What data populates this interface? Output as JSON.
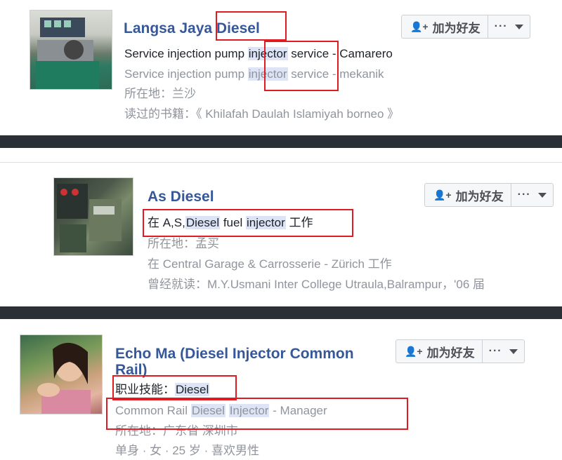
{
  "add_friend_label": "加为好友",
  "more_label": "···",
  "results": [
    {
      "name": "Langsa Jaya Diesel",
      "name_parts": [
        "Langsa Jaya ",
        "Diesel"
      ],
      "line1": [
        "Service injection pump ",
        "injector",
        " service - Camarero"
      ],
      "line2": [
        "Service injection pump ",
        "injector",
        " service - mekanik"
      ],
      "line3": "所在地：兰沙",
      "line4": "读过的书籍：《 Khilafah Daulah Islamiyah borneo 》"
    },
    {
      "name": "As Diesel",
      "line1": [
        "在 A,S,",
        "Diesel",
        " fuel ",
        "injector",
        " 工作"
      ],
      "line2": "所在地：孟买",
      "line3": "在 Central Garage & Carrosserie - Zürich 工作",
      "line4": "曾经就读：M.Y.Usmani Inter College Utraula,Balrampur，'06 届"
    },
    {
      "name": "Echo Ma (Diesel Injector Common Rail)",
      "name_line1": "Echo Ma (Diesel Injector Common",
      "name_line2": "Rail)",
      "line1": [
        "职业技能：",
        "Diesel"
      ],
      "line2": [
        "Common Rail ",
        "Diesel",
        " ",
        "Injector",
        " - Manager"
      ],
      "line3": "所在地：广东省 深圳市",
      "line4": "单身 · 女 · 25 岁 · 喜欢男性"
    }
  ],
  "colors": {
    "link": "#365899",
    "highlight": "#dce4f5",
    "annotation": "#e01b22"
  },
  "icons": [
    "add-friend-icon",
    "caret-down-icon"
  ]
}
